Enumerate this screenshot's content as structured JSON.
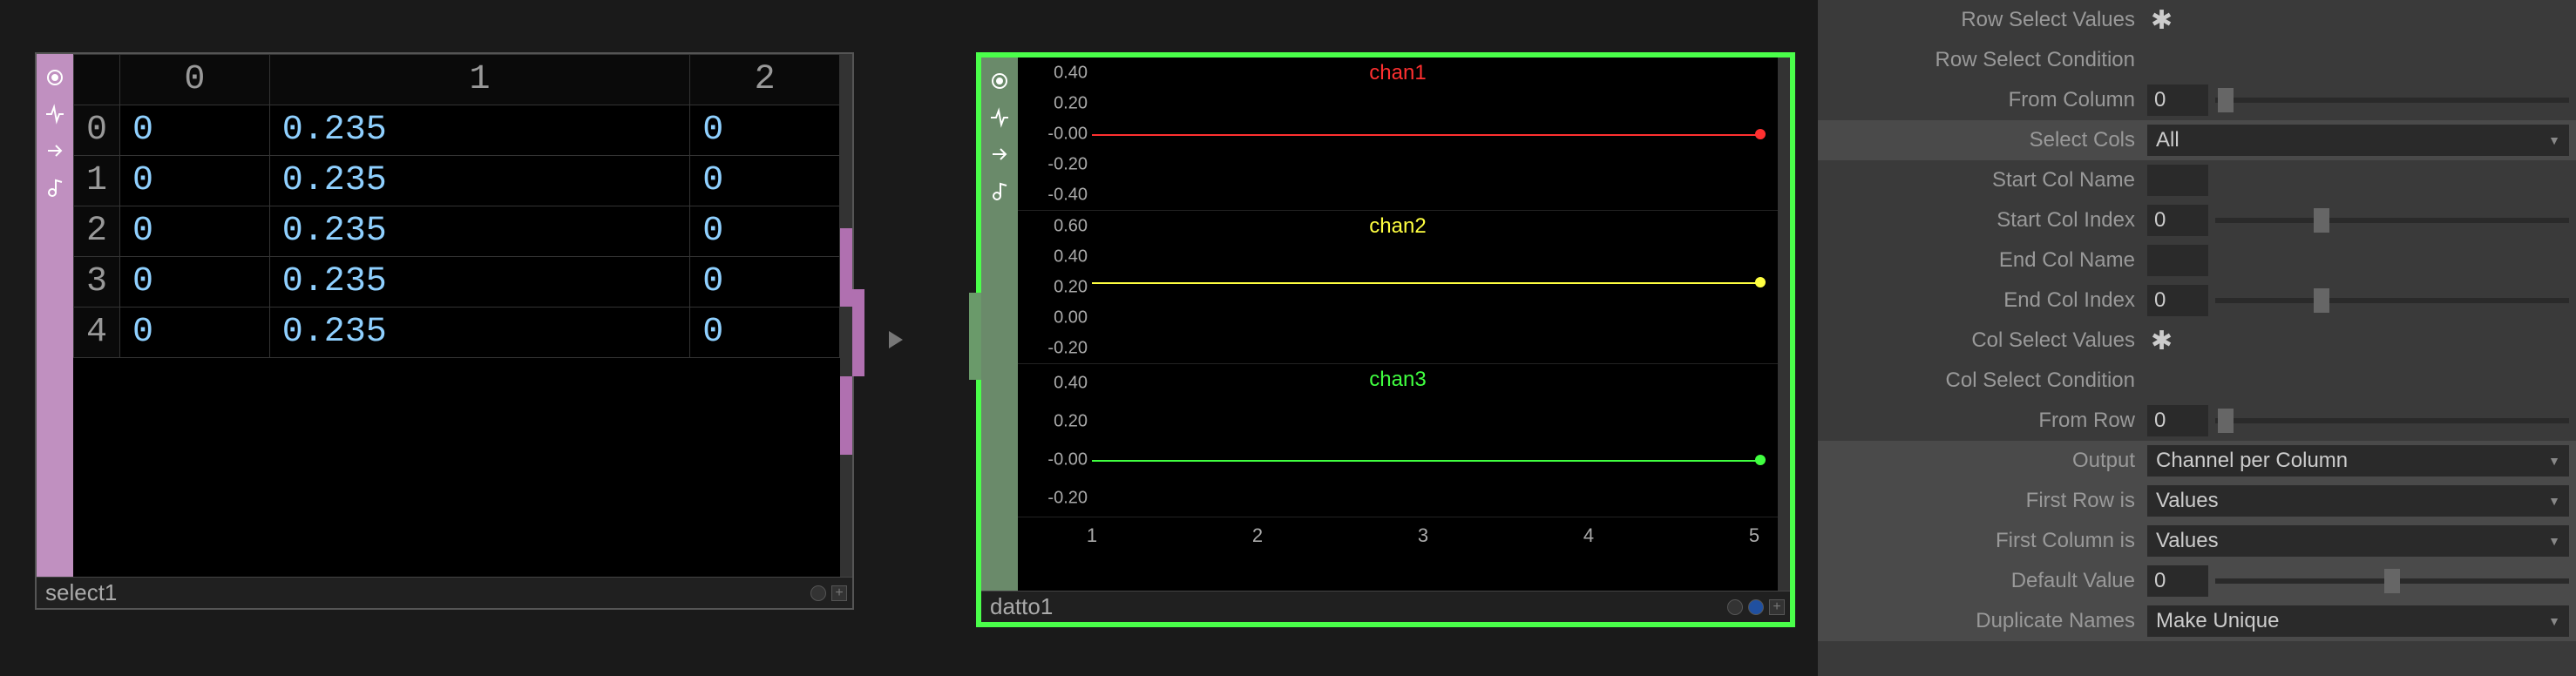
{
  "nodes": {
    "select1": {
      "name": "select1",
      "columns": [
        "0",
        "1",
        "2"
      ],
      "rows": [
        {
          "idx": "0",
          "c0": "0",
          "c1": "0.235",
          "c2": "0"
        },
        {
          "idx": "1",
          "c0": "0",
          "c1": "0.235",
          "c2": "0"
        },
        {
          "idx": "2",
          "c0": "0",
          "c1": "0.235",
          "c2": "0"
        },
        {
          "idx": "3",
          "c0": "0",
          "c1": "0.235",
          "c2": "0"
        },
        {
          "idx": "4",
          "c0": "0",
          "c1": "0.235",
          "c2": "0"
        }
      ]
    },
    "datto1": {
      "name": "datto1",
      "channels": [
        {
          "name": "chan1",
          "color": "#ff3030",
          "value": 0,
          "yticks": [
            "0.40",
            "0.20",
            "-0.00",
            "-0.20",
            "-0.40"
          ],
          "ymin": -0.5,
          "ymax": 0.5
        },
        {
          "name": "chan2",
          "color": "#ffff40",
          "value": 0.235,
          "yticks": [
            "0.60",
            "0.40",
            "0.20",
            "0.00",
            "-0.20"
          ],
          "ymin": -0.3,
          "ymax": 0.7
        },
        {
          "name": "chan3",
          "color": "#40ff40",
          "value": 0,
          "yticks": [
            "0.40",
            "0.20",
            "-0.00",
            "-0.20"
          ],
          "ymin": -0.3,
          "ymax": 0.5
        }
      ],
      "xticks": [
        "1",
        "2",
        "3",
        "4",
        "5"
      ]
    }
  },
  "params": {
    "row_select_values": {
      "label": "Row Select Values"
    },
    "row_select_condition": {
      "label": "Row Select Condition"
    },
    "from_column": {
      "label": "From Column",
      "value": "0"
    },
    "select_cols": {
      "label": "Select Cols",
      "value": "All"
    },
    "start_col_name": {
      "label": "Start Col Name",
      "value": ""
    },
    "start_col_index": {
      "label": "Start Col Index",
      "value": "0"
    },
    "end_col_name": {
      "label": "End Col Name",
      "value": ""
    },
    "end_col_index": {
      "label": "End Col Index",
      "value": "0"
    },
    "col_select_values": {
      "label": "Col Select Values"
    },
    "col_select_condition": {
      "label": "Col Select Condition"
    },
    "from_row": {
      "label": "From Row",
      "value": "0"
    },
    "output": {
      "label": "Output",
      "value": "Channel per Column"
    },
    "first_row_is": {
      "label": "First Row is",
      "value": "Values"
    },
    "first_column_is": {
      "label": "First Column is",
      "value": "Values"
    },
    "default_value": {
      "label": "Default Value",
      "value": "0"
    },
    "duplicate_names": {
      "label": "Duplicate Names",
      "value": "Make Unique"
    }
  }
}
